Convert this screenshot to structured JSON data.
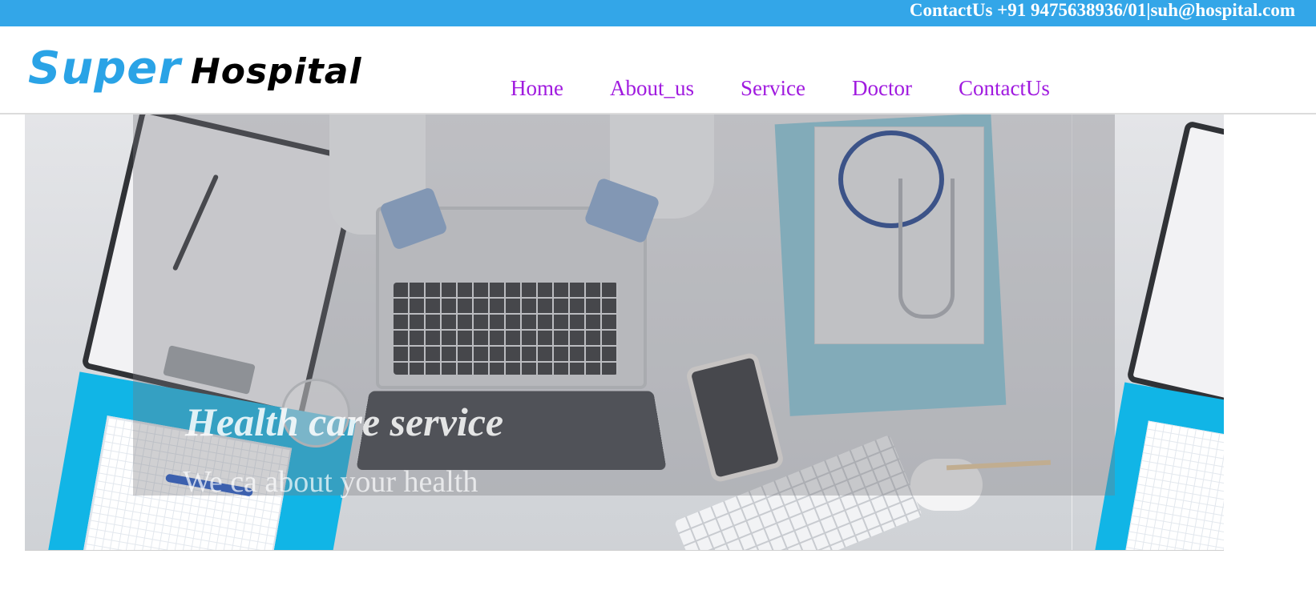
{
  "topbar": {
    "contact_text": "ContactUs +91 9475638936/01|suh@hospital.com"
  },
  "logo": {
    "word1": "Super",
    "word2": "Hospital"
  },
  "nav": {
    "items": [
      {
        "label": "Home"
      },
      {
        "label": "About_us"
      },
      {
        "label": "Service"
      },
      {
        "label": "Doctor"
      },
      {
        "label": "ContactUs"
      }
    ]
  },
  "hero": {
    "title": "Health care service",
    "subtitle": "We ca about your health"
  },
  "colors": {
    "topbar_bg": "#33a6e8",
    "logo_accent": "#2aa3e6",
    "nav_link": "#a01adf"
  }
}
